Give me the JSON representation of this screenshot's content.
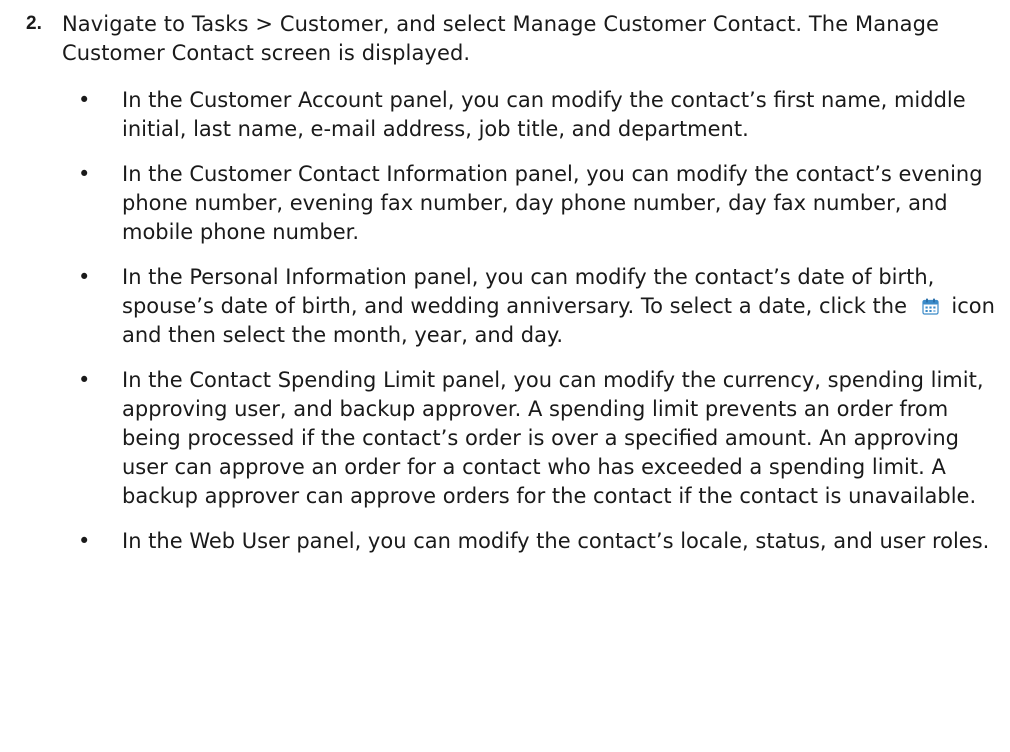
{
  "step": {
    "number": "2.",
    "intro": "Navigate to Tasks > Customer, and select Manage Customer Contact. The Manage Customer Contact screen is displayed."
  },
  "bullets": [
    {
      "text": "In the Customer Account panel, you can modify the contact’s first name, middle initial, last name, e-mail address, job title, and department."
    },
    {
      "text": "In the Customer Contact Information panel, you can modify the contact’s evening phone number, evening fax number, day phone number, day fax number, and mobile phone number."
    },
    {
      "text_before_icon": "In the Personal Information panel, you can modify the contact’s date of birth, spouse’s date of birth, and wedding anniversary. To select a date, click the",
      "icon": "calendar-icon",
      "text_after_icon": "icon and then select the month, year, and day."
    },
    {
      "text": "In the Contact Spending Limit panel, you can modify the currency, spending limit, approving user, and backup approver. A spending limit prevents an order from being processed if the contact’s order is over a specified amount. An approving user can approve an order for a contact who has exceeded a spending limit. A backup approver can approve orders for the contact if the contact is unavailable."
    },
    {
      "text": "In the Web User panel, you can modify the contact’s locale, status, and user roles."
    }
  ],
  "bullet_glyph": "•",
  "colors": {
    "text": "#1a1a1a",
    "calendar_icon": "#3a8ac8"
  }
}
